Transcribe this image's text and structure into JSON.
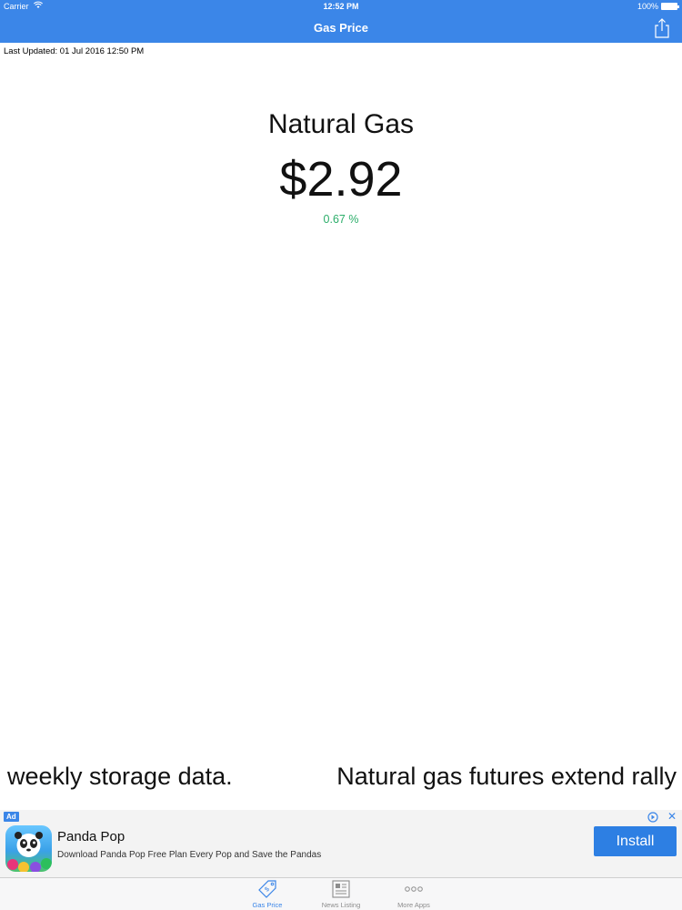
{
  "status_bar": {
    "carrier": "Carrier",
    "time": "12:52 PM",
    "battery": "100%"
  },
  "nav": {
    "title": "Gas Price",
    "share_icon": "share-icon"
  },
  "last_updated": "Last Updated: 01 Jul 2016 12:50 PM",
  "quote": {
    "name": "Natural Gas",
    "price": "$2.92",
    "change": "0.67 %",
    "change_color": "#2cae6a"
  },
  "ticker": {
    "items": [
      "weekly storage data.",
      "Natural gas futures extend rally"
    ]
  },
  "ad": {
    "badge": "Ad",
    "app_title": "Panda Pop",
    "app_desc": "Download Panda Pop Free Plan Every Pop and Save the Pandas",
    "install_label": "Install",
    "close_label": "✕"
  },
  "tabs": [
    {
      "label": "Gas Price",
      "icon": "price-tag-icon",
      "active": true
    },
    {
      "label": "News Listing",
      "icon": "newspaper-icon",
      "active": false
    },
    {
      "label": "More Apps",
      "icon": "more-dots-icon",
      "active": false
    }
  ],
  "colors": {
    "accent": "#3b86e8",
    "positive": "#2cae6a"
  }
}
